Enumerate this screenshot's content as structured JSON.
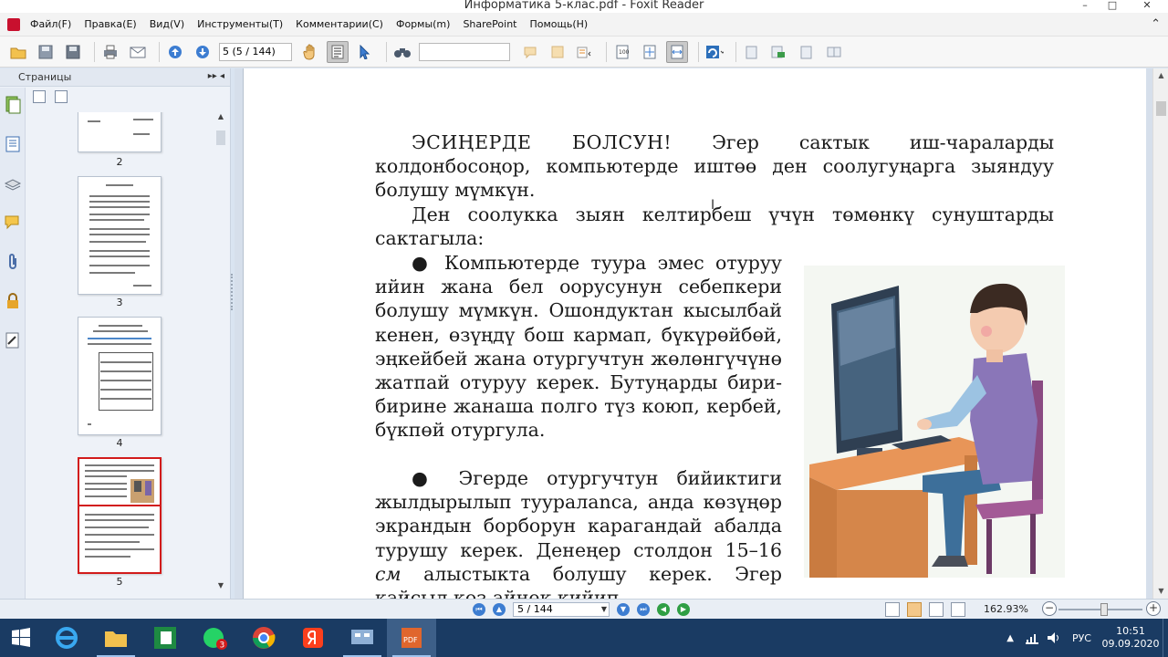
{
  "window": {
    "title": "Информатика 5-клас.pdf - Foxit Reader",
    "minimize": "–",
    "maximize": "□",
    "close": "✕"
  },
  "menu": {
    "items": [
      {
        "label": "Файл(F)"
      },
      {
        "label": "Правка(E)"
      },
      {
        "label": "Вид(V)"
      },
      {
        "label": "Инструменты(T)"
      },
      {
        "label": "Комментарии(C)"
      },
      {
        "label": "Формы(m)"
      },
      {
        "label": "SharePoint"
      },
      {
        "label": "Помощь(H)"
      }
    ],
    "collapse_icon": "⌃"
  },
  "toolbar": {
    "page_value": "5 (5 / 144)",
    "search_value": ""
  },
  "left_panel": {
    "title": "Страницы",
    "header_icons": "▸▸ ◂",
    "thumbnails": [
      {
        "label": "2"
      },
      {
        "label": "3"
      },
      {
        "label": "4"
      },
      {
        "label": "5"
      }
    ]
  },
  "document": {
    "p1_bold": "ЭСИҢЕРДЕ БОЛСУН!",
    "p1_rest": " Эгер сактык иш-чараларды колдонбосоңор, компьютерде иштөө ден соолугуңарга зыяндуу болушу мүмкүн.",
    "p2": "Ден соолукка зыян келтирбеш үчүн төмөнкү сунуштарды сактагыла:",
    "bullet1": "● Компьютерде туура эмес отуруу ийин жана бел оорусунун себепкери болушу мүмкүн. Ошондуктан кысылбай кенен, өзүңдү бош кармап, бүкүрөйбөй, эңкейбей жана отургучтун жөлөнгүчүнө жатпай отуруу керек. Бутуңарды бири-бирине жанаша полго түз коюп, кербей, бүкпөй отургула.",
    "bullet2_a": "● Эгерде отургучтун бийиктиги жылдырылып тууралanса, анда көзүңөр экрандын борборун карагандай абалда турушу керек. Денеңер столдон 15–16 ",
    "bullet2_unit": "см",
    "bullet2_b": " алыстыкта болушу керек. Эгер кайсыл көз айнек кийип"
  },
  "statusbar": {
    "page_value": "5 / 144",
    "zoom": "162.93%",
    "zoom_level_fraction": 0.55
  },
  "taskbar": {
    "apps": [
      {
        "name": "internet-explorer-icon"
      },
      {
        "name": "file-explorer-icon"
      },
      {
        "name": "excel-icon"
      },
      {
        "name": "whatsapp-icon",
        "badge": "3"
      },
      {
        "name": "chrome-icon"
      },
      {
        "name": "yandex-icon"
      },
      {
        "name": "network-app-icon"
      },
      {
        "name": "foxit-pdf-icon"
      }
    ],
    "lang": "РУС",
    "time": "10:51",
    "date": "09.09.2020",
    "tray_arrow": "▲"
  },
  "colors": {
    "accent": "#3d7dd1",
    "current_thumb_border": "#d21b1b",
    "taskbar": "#1a3b63"
  }
}
